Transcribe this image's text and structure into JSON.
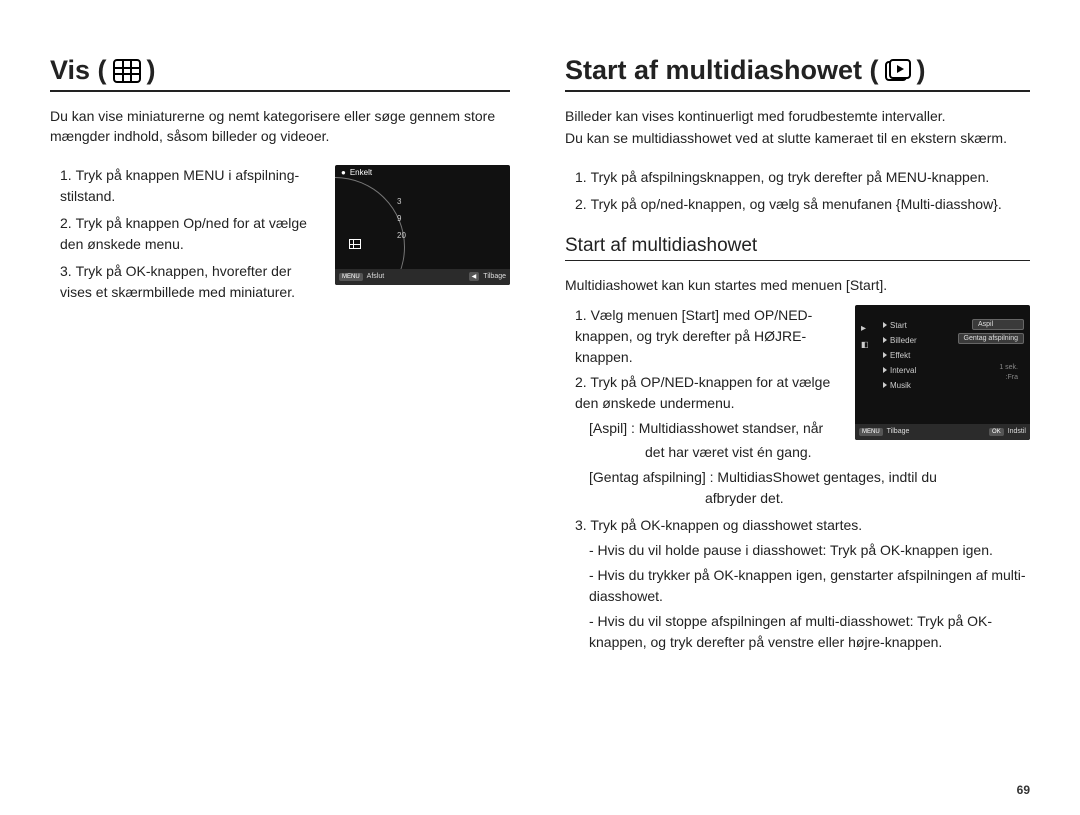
{
  "page_number": "69",
  "left": {
    "title": "Vis (",
    "title_close": ")",
    "intro": "Du kan vise miniaturerne og nemt kategorisere eller søge gennem store mængder indhold, såsom billeder og videoer.",
    "steps": [
      "Tryk på knappen MENU i afspilning-stilstand.",
      "Tryk på knappen Op/ned for at vælge den ønskede menu.",
      "Tryk på OK-knappen, hvorefter der vises et skærmbillede med miniaturer."
    ],
    "screenshot": {
      "top_icon_label": "Enkelt",
      "arc_values": [
        "3",
        "9",
        "20"
      ],
      "bottom_left_btn": "MENU",
      "bottom_left_label": "Afslut",
      "bottom_right_btn": "◀",
      "bottom_right_label": "Tilbage"
    }
  },
  "right": {
    "title": "Start af multidiashowet (",
    "title_close": ")",
    "intro1": "Billeder kan vises kontinuerligt med forudbestemte intervaller.",
    "intro2": "Du kan se multidiasshowet ved at slutte kameraet til en ekstern skærm.",
    "pre_steps": [
      "Tryk på afspilningsknappen, og tryk derefter på MENU-knappen.",
      "Tryk på op/ned-knappen, og vælg så menufanen {Multi-diasshow}."
    ],
    "subtitle": "Start af multidiashowet",
    "sub_intro": "Multidiashowet kan kun startes med menuen [Start].",
    "step1": "Vælg menuen [Start] med OP/NED-knappen, og tryk derefter på HØJRE-knappen.",
    "step2": "Tryk på OP/NED-knappen for at vælge den ønskede undermenu.",
    "step2_aspil_label": "[Aspil] :",
    "step2_aspil_text1": "Multidiasshowet standser, når",
    "step2_aspil_text2": "det har været vist én gang.",
    "step2_gentag_label": "[Gentag afspilning] :",
    "step2_gentag_text1": "MultidiasShowet gentages, indtil du",
    "step2_gentag_text2": "afbryder det.",
    "step3": "Tryk på OK-knappen og diasshowet startes.",
    "step3_b1": "- Hvis du vil holde pause i diasshowet: Tryk på OK-knappen igen.",
    "step3_b2": "- Hvis du trykker på OK-knappen igen, genstarter afspilningen af multi-diasshowet.",
    "step3_b3": "- Hvis du vil stoppe afspilningen af multi-diasshowet: Tryk på OK-knappen, og tryk derefter på venstre eller højre-knappen.",
    "screenshot": {
      "menu": [
        "Start",
        "Billeder",
        "Effekt",
        "Interval",
        "Musik"
      ],
      "right_pills": [
        "Aspil",
        "Gentag afspilning"
      ],
      "right_vals": [
        "1 sek.",
        ":Fra"
      ],
      "bottom_left_btn": "MENU",
      "bottom_left_label": "Tilbage",
      "bottom_right_btn": "OK",
      "bottom_right_label": "Indstil"
    }
  }
}
